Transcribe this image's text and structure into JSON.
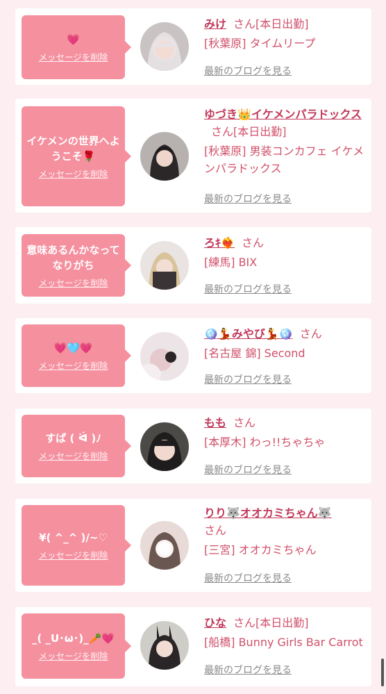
{
  "delete_label": "メッセージを削除",
  "blog_label": "最新のブログを見る",
  "san": "さん",
  "items": [
    {
      "message": "💗",
      "name": "みけ",
      "status": "[本日出勤]",
      "shop": "[秋葉原] タイムリープ"
    },
    {
      "message": "イケメンの世界へようこそ🌹",
      "name": "ゆづき👑イケメンパラドックス",
      "status": "[本日出勤]",
      "shop": "[秋葉原] 男装コンカフェ イケメンパラドックス"
    },
    {
      "message": "意味あるんかなってなりがち",
      "name": "ろｷ❤️‍🔥",
      "status": "",
      "shop": "[練馬] BIX"
    },
    {
      "message": "💗🩵💗",
      "name": "🪩💃みやび💃🪩",
      "status": "",
      "shop": "[名古屋 錦] Second"
    },
    {
      "message": "すぱ ( ᐛ )ﾉ",
      "name": "もも",
      "status": "",
      "shop": "[本厚木] わっ!!ちゃちゃ"
    },
    {
      "message": "¥( ^_^ )/~♡",
      "name": "りり🐺オオカミちゃん🐺",
      "status": "",
      "shop": "[三宮] オオカミちゃん"
    },
    {
      "message": "_( _U･ω･)_🥕💗",
      "name": "ひな",
      "status": "[本日出勤]",
      "shop": "[船橋] Bunny Girls Bar Carrot"
    }
  ],
  "colors": {
    "accent": "#f5909f",
    "name": "#c0395a",
    "background": "#fdeef1"
  }
}
